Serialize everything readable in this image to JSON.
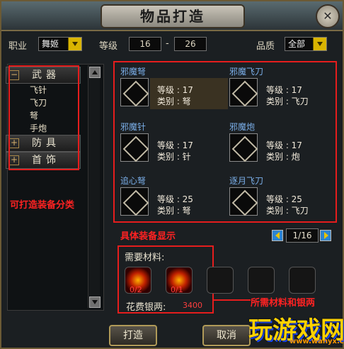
{
  "window": {
    "title": "物品打造",
    "close_icon": "close-icon"
  },
  "filters": {
    "class_label": "职业",
    "class_value": "舞姬",
    "level_label": "等级",
    "level_min": "16",
    "level_sep": "-",
    "level_max": "26",
    "quality_label": "品质",
    "quality_value": "全部"
  },
  "categories": [
    {
      "label": "武器",
      "expanded": true,
      "subitems": [
        "飞针",
        "飞刀",
        "弩",
        "手炮"
      ]
    },
    {
      "label": "防具",
      "expanded": false
    },
    {
      "label": "首饰",
      "expanded": false
    }
  ],
  "items": [
    {
      "name": "邪魔弩",
      "level": "等级 : 17",
      "type": "类别 : 弩",
      "selected": true,
      "icon": "crossbow-icon"
    },
    {
      "name": "邪魔飞刀",
      "level": "等级 : 17",
      "type": "类别 : 飞刀",
      "selected": false,
      "icon": "throwing-knife-icon"
    },
    {
      "name": "邪魔针",
      "level": "等级 : 17",
      "type": "类别 : 针",
      "selected": false,
      "icon": "needle-icon"
    },
    {
      "name": "邪魔炮",
      "level": "等级 : 17",
      "type": "类别 : 炮",
      "selected": false,
      "icon": "hand-cannon-icon"
    },
    {
      "name": "追心弩",
      "level": "等级 : 25",
      "type": "类别 : 弩",
      "selected": false,
      "icon": "crossbow-icon"
    },
    {
      "name": "逐月飞刀",
      "level": "等级 : 25",
      "type": "类别 : 飞刀",
      "selected": false,
      "icon": "throwing-knife-icon"
    }
  ],
  "annotations": {
    "categories_note": "可打造装备分类",
    "items_note": "具体装备显示",
    "materials_note": "所需材料和银两"
  },
  "pager": {
    "value": "1/16"
  },
  "materials": {
    "label": "需要材料:",
    "slots": [
      {
        "filled": true,
        "count": "0/2"
      },
      {
        "filled": true,
        "count": "0/1"
      },
      {
        "filled": false
      },
      {
        "filled": false
      },
      {
        "filled": false
      }
    ],
    "cost_label": "花费银两:",
    "cost_value": "3400"
  },
  "buttons": {
    "craft": "打造",
    "cancel": "取消"
  },
  "watermark": {
    "text": "玩游戏网",
    "url": "www.wanyx.com"
  },
  "colors": {
    "accent_red": "#e51d1d",
    "item_name_blue": "#7aaee8",
    "cost_red": "#ff3e3e"
  }
}
